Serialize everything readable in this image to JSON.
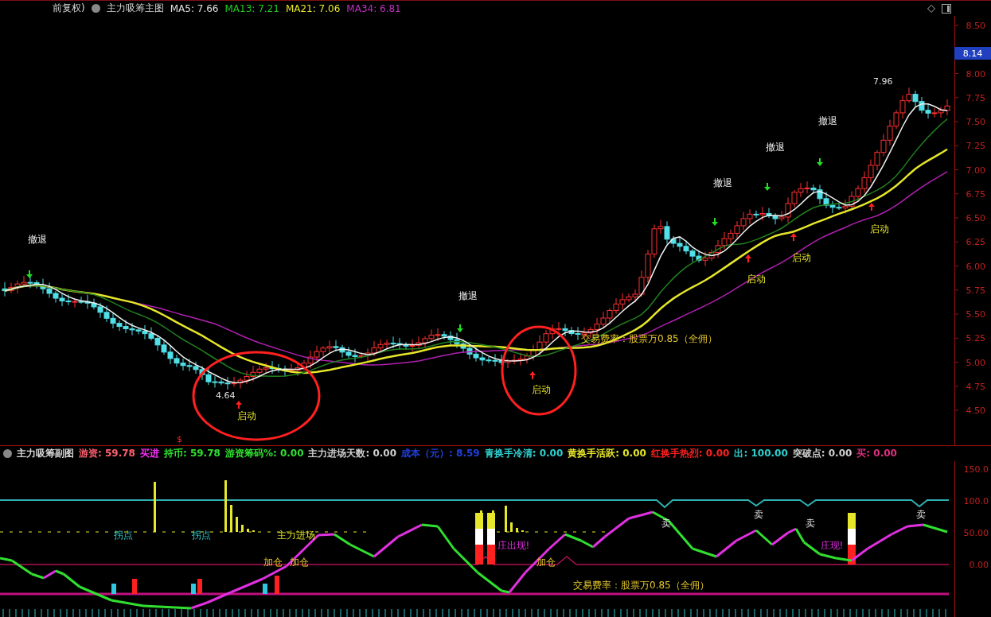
{
  "main_header": {
    "source": "前复权)",
    "title": "主力吸筹主图",
    "items": [
      {
        "text": "MA5: 7.66",
        "color": "#e0e0e0"
      },
      {
        "text": "MA13: 7.21",
        "color": "#22cc22"
      },
      {
        "text": "MA21: 7.06",
        "color": "#e6e62a"
      },
      {
        "text": "MA34: 6.81",
        "color": "#c030c0"
      }
    ]
  },
  "price_axis": {
    "ticks": [
      "8.50",
      "8.00",
      "7.75",
      "7.50",
      "7.25",
      "7.00",
      "6.75",
      "6.50",
      "6.25",
      "6.00",
      "5.75",
      "5.50",
      "5.25",
      "5.00",
      "4.75",
      "4.50"
    ],
    "current_price": "8.14"
  },
  "main_chart": {
    "signals": [
      {
        "kind": "exit",
        "text": "撤退"
      },
      {
        "kind": "exit",
        "text": "撤退"
      },
      {
        "kind": "exit",
        "text": "撤退"
      },
      {
        "kind": "exit",
        "text": "撤退"
      },
      {
        "kind": "exit",
        "text": "撤退"
      },
      {
        "kind": "start",
        "text": "启动"
      },
      {
        "kind": "start",
        "text": "启动"
      },
      {
        "kind": "start",
        "text": "启动"
      },
      {
        "kind": "start",
        "text": "启动"
      },
      {
        "kind": "start",
        "text": "启动"
      }
    ],
    "price_marks": [
      "4.64",
      "7.96"
    ],
    "fee_note": "交易费率：股票万0.85（全佣）",
    "marker": "$"
  },
  "sub_header": {
    "title": "主力吸筹副图",
    "items": [
      {
        "text": "游资: 59.78",
        "color": "#ff6070"
      },
      {
        "text": "买进",
        "color": "#ff30ff"
      },
      {
        "text": "持币: 59.78",
        "color": "#30e030"
      },
      {
        "text": "游资筹码%: 0.00",
        "color": "#30e030"
      },
      {
        "text": "主力进场天数: 0.00",
        "color": "#d0d0d0"
      },
      {
        "text": "成本（元）: 8.59",
        "color": "#2040e0"
      },
      {
        "text": "青换手冷清: 0.00",
        "color": "#30d0d0"
      },
      {
        "text": "黄换手活跃: 0.00",
        "color": "#e6e62a"
      },
      {
        "text": "红换手热烈: 0.00",
        "color": "#ff2020"
      },
      {
        "text": "出: 100.00",
        "color": "#30d0d0"
      },
      {
        "text": "突破点: 0.00",
        "color": "#d0d0d0"
      },
      {
        "text": "买: 0.00",
        "color": "#e03080"
      }
    ]
  },
  "sub_axis": {
    "ticks": [
      "150.0",
      "100.0",
      "50.00",
      "0.00"
    ]
  },
  "sub_chart": {
    "labels": [
      {
        "kind": "turn",
        "text": "拐点"
      },
      {
        "kind": "turn",
        "text": "拐点"
      },
      {
        "kind": "entry",
        "text": "主力进场"
      },
      {
        "kind": "add",
        "text": "加仓"
      },
      {
        "kind": "add",
        "text": "加仓"
      },
      {
        "kind": "add",
        "text": "加仓"
      },
      {
        "kind": "sell",
        "text": "卖"
      },
      {
        "kind": "sell",
        "text": "卖"
      },
      {
        "kind": "sell",
        "text": "卖"
      },
      {
        "kind": "sell",
        "text": "卖"
      },
      {
        "kind": "dealer",
        "text": "庄出现!"
      },
      {
        "kind": "dealer",
        "text": "庄现!"
      }
    ],
    "fee_note": "交易费率：股票万0.85（全佣）"
  }
}
